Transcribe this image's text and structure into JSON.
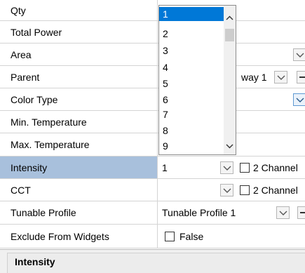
{
  "properties": [
    {
      "label": "Qty",
      "value": ""
    },
    {
      "label": "Total Power",
      "value": ""
    },
    {
      "label": "Area",
      "value": ""
    },
    {
      "label": "Parent",
      "value": "way 1"
    },
    {
      "label": "Color Type",
      "value": ""
    },
    {
      "label": "Min. Temperature",
      "value": ""
    },
    {
      "label": "Max. Temperature",
      "value": ""
    },
    {
      "label": "Intensity",
      "value": "1",
      "checkbox_label": "2 Channel",
      "selected": true
    },
    {
      "label": "CCT",
      "value": "",
      "checkbox_label": "2 Channel"
    },
    {
      "label": "Tunable Profile",
      "value": "Tunable Profile 1"
    },
    {
      "label": "Exclude From Widgets",
      "value": "False",
      "checked": false
    }
  ],
  "qty_dropdown": {
    "options": [
      "1",
      "2",
      "3",
      "4",
      "5",
      "6",
      "7",
      "8",
      "9"
    ],
    "selected": "1"
  },
  "description": {
    "title": "Intensity"
  },
  "colors": {
    "selected_row": "#a8c0dc",
    "highlight": "#0078d7",
    "dropdown_focus": "#5f9ad3"
  },
  "icons": {
    "dropdown": "chevron-down-icon",
    "scroll_up": "chevron-up-icon",
    "scroll_down": "chevron-down-icon",
    "remove": "minus-icon"
  }
}
